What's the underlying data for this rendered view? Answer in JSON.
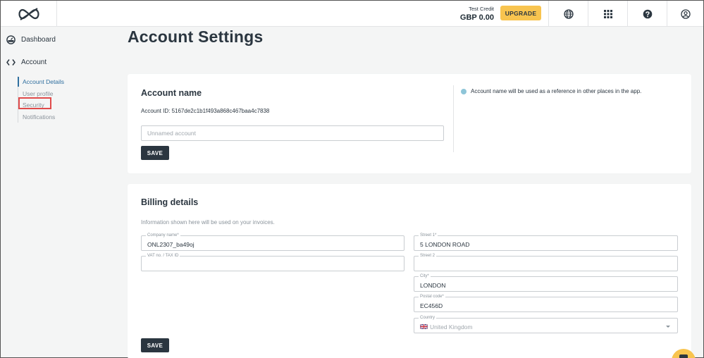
{
  "header": {
    "credit_label": "Test Credit",
    "credit_value": "GBP 0.00",
    "upgrade_label": "UPGRADE",
    "icons": [
      "logo-icon",
      "globe-icon",
      "apps-grid-icon",
      "help-icon",
      "user-account-icon"
    ]
  },
  "sidebar": {
    "dashboard_label": "Dashboard",
    "account_label": "Account",
    "subitems": [
      {
        "label": "Account Details",
        "active": true
      },
      {
        "label": "User profile",
        "active": false
      },
      {
        "label": "Security",
        "active": false
      },
      {
        "label": "Notifications",
        "active": false
      }
    ]
  },
  "main": {
    "page_title": "Account Settings",
    "account_card": {
      "title": "Account name",
      "account_id": "Account ID: 5167de2c1b1f493a868c467baa4c7838",
      "name_placeholder": "Unnamed account",
      "save_label": "SAVE",
      "info_text": "Account name will be used as a reference in other places in the app."
    },
    "billing_card": {
      "title": "Billing details",
      "subtitle": "Information shown here will be used on your invoices.",
      "company_label": "Company name*",
      "company_value": "ONL2307_ba49oj",
      "vat_label": "VAT no. / TAX ID",
      "vat_value": "",
      "street1_label": "Street 1*",
      "street1_value": "5 LONDON ROAD",
      "street2_label": "Street 2",
      "street2_value": "",
      "city_label": "City*",
      "city_value": "LONDON",
      "postal_label": "Postal code*",
      "postal_value": "EC456D",
      "country_label": "Country",
      "country_value": "United Kingdom",
      "save_label": "SAVE"
    }
  },
  "colors": {
    "accent": "#2f6f9f",
    "upgrade": "#f8c44f",
    "dark_button": "#2b3640",
    "highlight": "#e04b4b"
  }
}
